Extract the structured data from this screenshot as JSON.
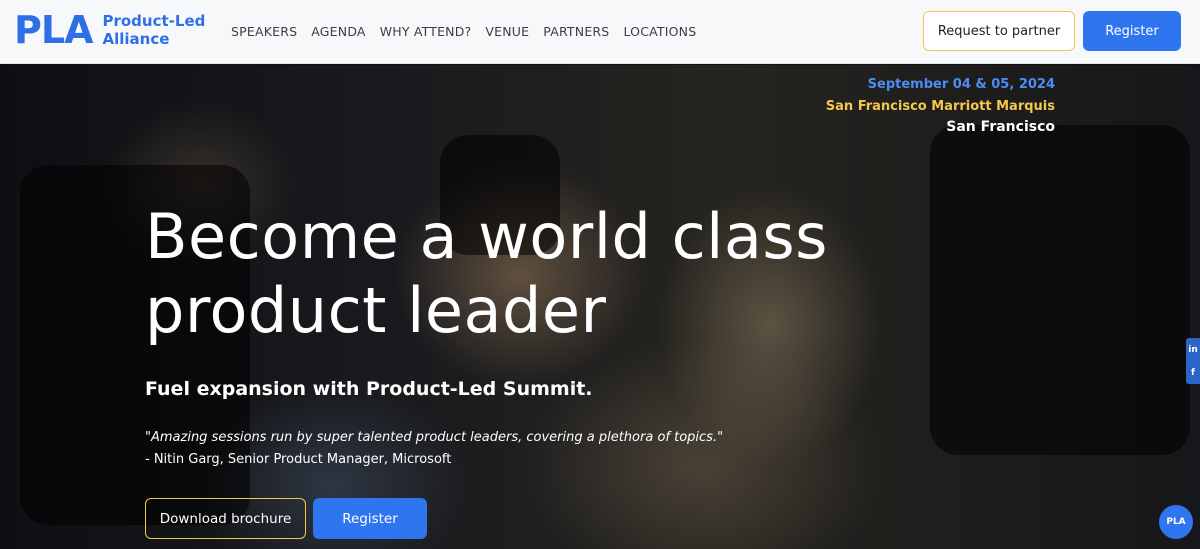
{
  "brand": {
    "mark": "PLA",
    "name_line1": "Product-Led",
    "name_line2": "Alliance",
    "accent_color": "#2f6fe6"
  },
  "nav": {
    "items": [
      "SPEAKERS",
      "AGENDA",
      "WHY ATTEND?",
      "VENUE",
      "PARTNERS",
      "LOCATIONS"
    ]
  },
  "header_actions": {
    "partner_label": "Request to partner",
    "register_label": "Register"
  },
  "event": {
    "date": "September 04 & 05, 2024",
    "venue": "San Francisco Marriott Marquis",
    "city": "San Francisco"
  },
  "hero": {
    "headline": "Become a world class product leader",
    "subhead": "Fuel expansion with Product-Led Summit.",
    "quote": "\"Amazing sessions run by super talented product leaders, covering a plethora of topics.\"",
    "quote_author": "- Nitin Garg, Senior Product Manager, Microsoft",
    "brochure_label": "Download brochure",
    "register_label": "Register"
  },
  "social": {
    "linkedin_icon": "linkedin-icon",
    "facebook_icon": "facebook-icon",
    "linkedin_glyph": "in",
    "facebook_glyph": "f"
  },
  "chat": {
    "label": "PLA"
  }
}
